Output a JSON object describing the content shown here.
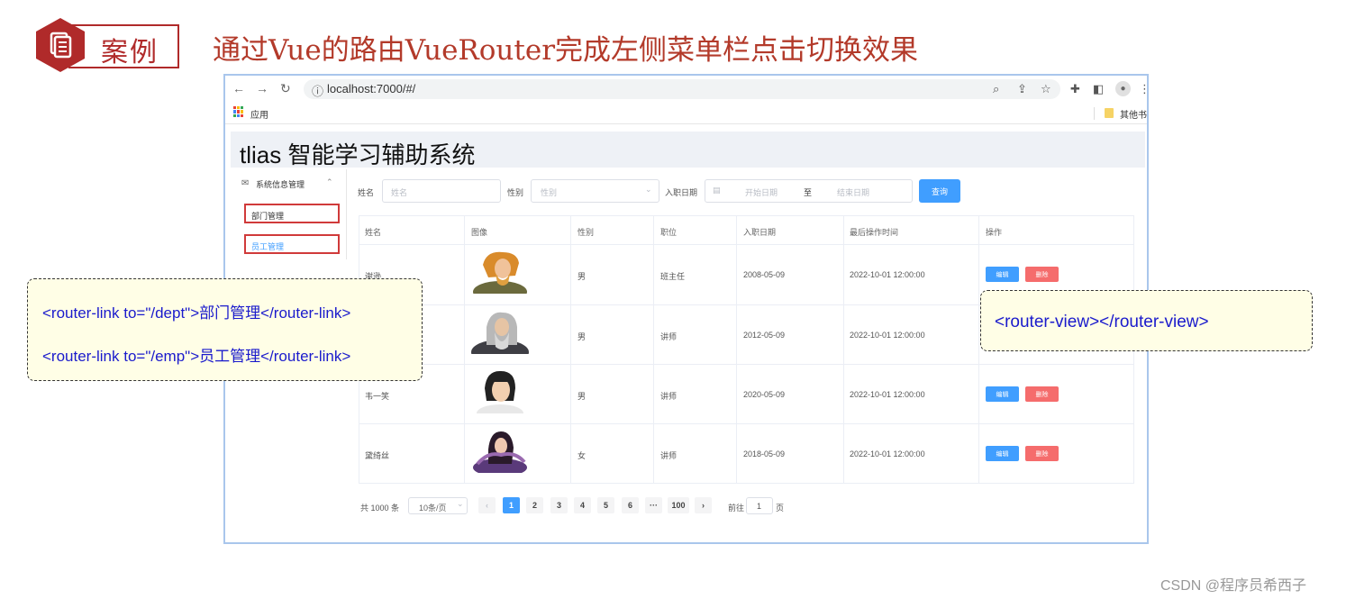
{
  "slide": {
    "badge_label": "案例",
    "title": "通过Vue的路由VueRouter完成左侧菜单栏点击切换效果",
    "watermark": "CSDN @程序员希西子"
  },
  "browser": {
    "url": "localhost:7000/#/",
    "bookmark_apps": "应用",
    "bookmark_other": "其他书",
    "icons": [
      "back-icon",
      "forward-icon",
      "reload-icon",
      "info-icon",
      "zoom-icon",
      "share-icon",
      "star-icon",
      "extensions-icon",
      "sidepanel-icon",
      "profile-icon",
      "menu-icon"
    ]
  },
  "app": {
    "title": "tlias 智能学习辅助系统",
    "sidebar": {
      "group": "系统信息管理",
      "items": [
        {
          "label": "部门管理",
          "active": false
        },
        {
          "label": "员工管理",
          "active": true
        }
      ]
    },
    "filters": {
      "name_label": "姓名",
      "name_placeholder": "姓名",
      "gender_label": "性别",
      "gender_placeholder": "性别",
      "date_label": "入职日期",
      "start_placeholder": "开始日期",
      "range_sep": "至",
      "end_placeholder": "结束日期",
      "query_button": "查询"
    },
    "table": {
      "columns": [
        "姓名",
        "图像",
        "性别",
        "职位",
        "入职日期",
        "最后操作时间",
        "操作"
      ],
      "rows": [
        {
          "name": "谢逊",
          "gender": "男",
          "job": "班主任",
          "entry": "2008-05-09",
          "updated": "2022-10-01 12:00:00"
        },
        {
          "name": "",
          "gender": "男",
          "job": "讲师",
          "entry": "2012-05-09",
          "updated": "2022-10-01 12:00:00"
        },
        {
          "name": "韦一笑",
          "gender": "男",
          "job": "讲师",
          "entry": "2020-05-09",
          "updated": "2022-10-01 12:00:00"
        },
        {
          "name": "黛绮丝",
          "gender": "女",
          "job": "讲师",
          "entry": "2018-05-09",
          "updated": "2022-10-01 12:00:00"
        }
      ],
      "edit_label": "编辑",
      "delete_label": "删除"
    },
    "pagination": {
      "total": "共 1000 条",
      "page_size": "10条/页",
      "pages": [
        "1",
        "2",
        "3",
        "4",
        "5",
        "6",
        "···",
        "100"
      ],
      "current": "1",
      "goto_label": "前往",
      "goto_value": "1",
      "goto_suffix": "页"
    }
  },
  "callouts": {
    "left_line1": "<router-link to=\"/dept\">部门管理</router-link>",
    "left_line2": "<router-link to=\"/emp\">员工管理</router-link>",
    "right": "<router-view></router-view>"
  },
  "colors": {
    "accent_red": "#b02a2a",
    "primary": "#409eff",
    "danger": "#f56c6c",
    "callout_bg": "#fffee6",
    "code_blue": "#1a1acc"
  }
}
